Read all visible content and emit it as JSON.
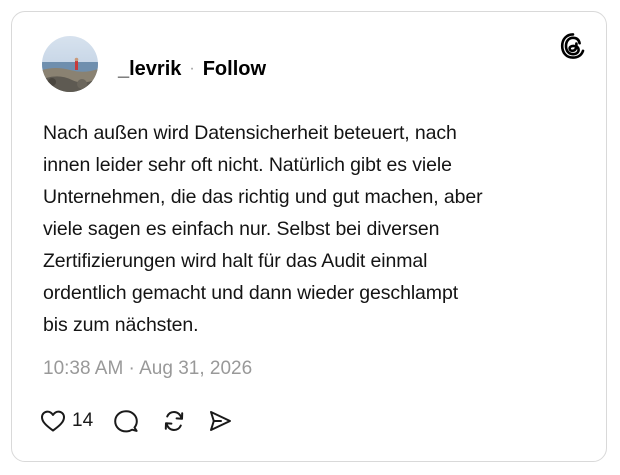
{
  "post": {
    "username": "_levrik",
    "separator": "·",
    "follow_label": "Follow",
    "body": "Nach außen wird Datensicherheit beteuert, nach\ninnen leider sehr oft nicht. Natürlich gibt es viele\nUnternehmen, die das richtig und gut machen, aber\nviele sagen es einfach nur. Selbst bei diversen\nZertifizierungen wird halt für das Audit einmal\nordentlich gemacht und dann wieder geschlampt\nbis zum nächsten.",
    "timestamp": "10:38 AM · Aug 31, 2026",
    "like_count": "14"
  },
  "icons": {
    "brand": "threads-logo-icon",
    "like": "heart-icon",
    "reply": "speech-bubble-icon",
    "repost": "repost-icon",
    "share": "send-icon"
  },
  "colors": {
    "text": "#141414",
    "muted": "#999999",
    "border": "#d9d9d9",
    "background": "#ffffff"
  }
}
